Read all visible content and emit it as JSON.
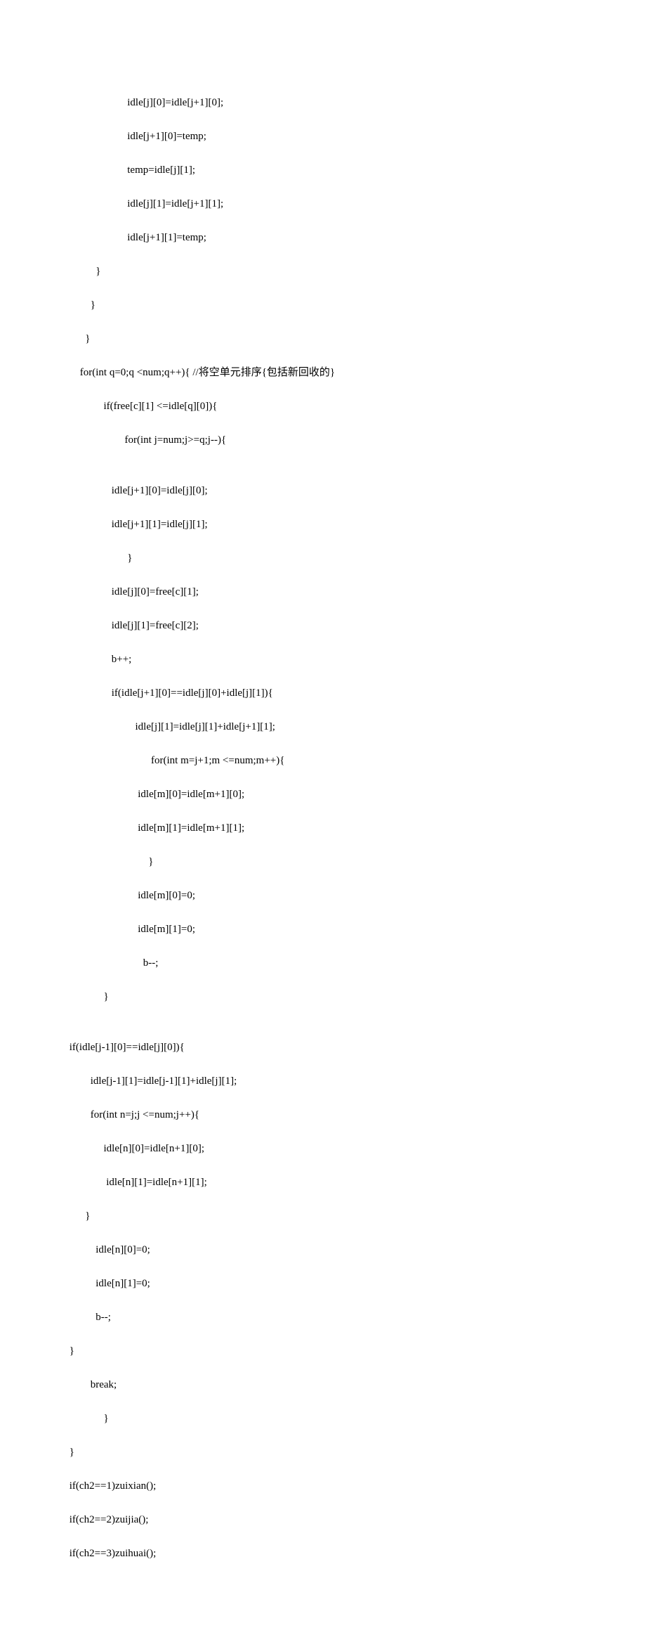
{
  "code": {
    "lines": [
      "                       idle[j][0]=idle[j+1][0];",
      "                       idle[j+1][0]=temp;",
      "                       temp=idle[j][1];",
      "                       idle[j][1]=idle[j+1][1];",
      "                       idle[j+1][1]=temp;",
      "           }",
      "         }",
      "       }",
      "     for(int q=0;q <num;q++){ //将空单元排序{包括新回收的}",
      "              if(free[c][1] <=idle[q][0]){",
      "                      for(int j=num;j>=q;j--){",
      "",
      "                 idle[j+1][0]=idle[j][0];",
      "                 idle[j+1][1]=idle[j][1];",
      "                       }",
      "                 idle[j][0]=free[c][1];",
      "                 idle[j][1]=free[c][2];",
      "                 b++;",
      "                 if(idle[j+1][0]==idle[j][0]+idle[j][1]){",
      "                          idle[j][1]=idle[j][1]+idle[j+1][1];",
      "                                for(int m=j+1;m <=num;m++){",
      "                           idle[m][0]=idle[m+1][0];",
      "                           idle[m][1]=idle[m+1][1];",
      "                               }",
      "                           idle[m][0]=0;",
      "                           idle[m][1]=0;",
      "                             b--;",
      "              }",
      "",
      " if(idle[j-1][0]==idle[j][0]){",
      "         idle[j-1][1]=idle[j-1][1]+idle[j][1];",
      "         for(int n=j;j <=num;j++){",
      "              idle[n][0]=idle[n+1][0];",
      "               idle[n][1]=idle[n+1][1];",
      "       }",
      "           idle[n][0]=0;",
      "           idle[n][1]=0;",
      "           b--;",
      " }",
      "         break;",
      "              }",
      " }",
      " if(ch2==1)zuixian();",
      " if(ch2==2)zuijia();",
      " if(ch2==3)zuihuai();"
    ]
  }
}
